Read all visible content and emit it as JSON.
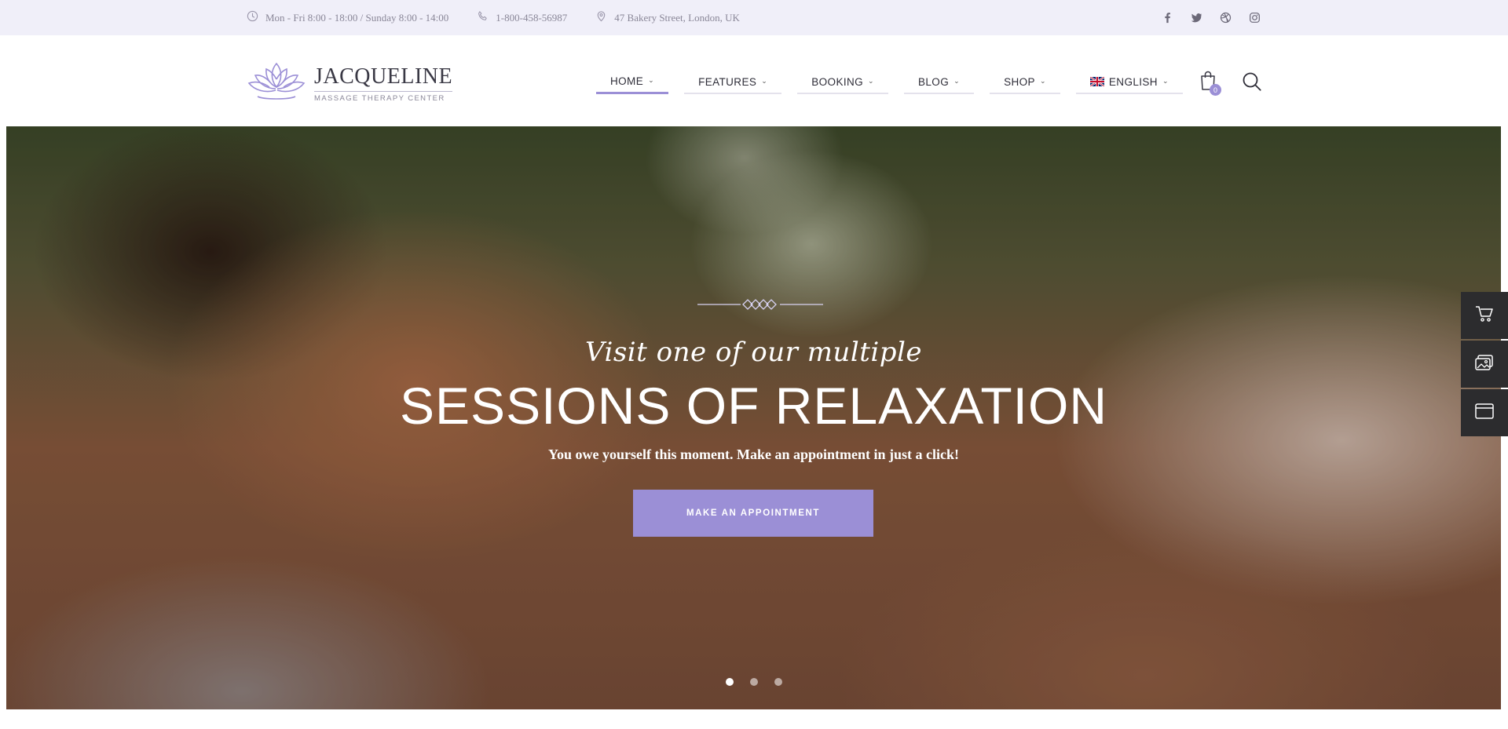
{
  "topbar": {
    "hours": "Mon - Fri 8:00 - 18:00 / Sunday 8:00 - 14:00",
    "phone": "1-800-458-56987",
    "address": "47 Bakery Street, London, UK",
    "socials": [
      "facebook-icon",
      "twitter-icon",
      "dribbble-icon",
      "instagram-icon"
    ]
  },
  "logo": {
    "title": "JACQUELINE",
    "subtitle": "MASSAGE THERAPY CENTER"
  },
  "nav": {
    "items": [
      {
        "label": "HOME"
      },
      {
        "label": "FEATURES"
      },
      {
        "label": "BOOKING"
      },
      {
        "label": "BLOG"
      },
      {
        "label": "SHOP"
      },
      {
        "label": "ENGLISH"
      }
    ],
    "cart_count": "0"
  },
  "hero": {
    "script_text": "Visit one of our multiple",
    "title": "SESSIONS OF RELAXATION",
    "subtitle": "You owe yourself this moment. Make an appointment in just a click!",
    "cta_label": "MAKE AN APPOINTMENT",
    "slides": 3,
    "active_slide": 1
  },
  "dock": [
    "cart-icon",
    "gallery-icon",
    "window-icon"
  ],
  "colors": {
    "accent": "#9b8fd6",
    "topbar_bg": "#f0eff9",
    "dock_bg": "#2c2c2e"
  }
}
